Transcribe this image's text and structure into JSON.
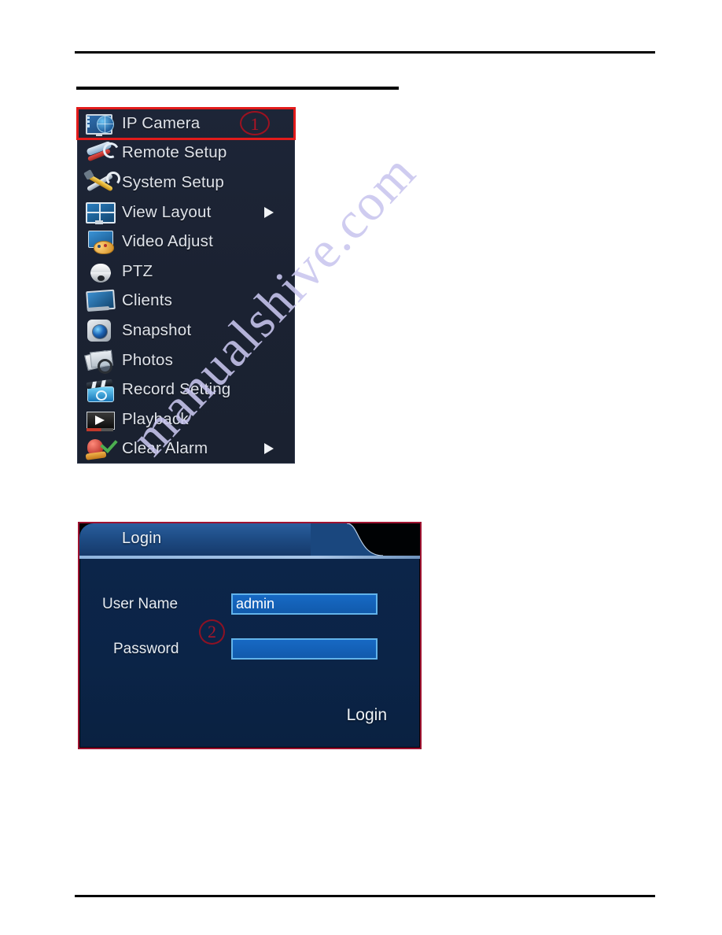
{
  "page": {
    "background_color": "#ffffff",
    "watermark": "manualshive.com",
    "watermark_color": "#c9c6ef"
  },
  "rules": {
    "top": "",
    "heading": "",
    "bottom": ""
  },
  "context_menu": {
    "panel_color": "#1b2232",
    "highlight_color": "#e21b1b",
    "annotation_badge": "1",
    "items": [
      {
        "label": "IP Camera",
        "icon": "ip-camera-icon",
        "has_submenu": false,
        "highlighted": true
      },
      {
        "label": "Remote Setup",
        "icon": "remote-setup-icon",
        "has_submenu": false,
        "highlighted": false
      },
      {
        "label": "System Setup",
        "icon": "system-setup-icon",
        "has_submenu": false,
        "highlighted": false
      },
      {
        "label": "View Layout",
        "icon": "view-layout-icon",
        "has_submenu": true,
        "highlighted": false
      },
      {
        "label": "Video Adjust",
        "icon": "video-adjust-icon",
        "has_submenu": false,
        "highlighted": false
      },
      {
        "label": "PTZ",
        "icon": "ptz-camera-icon",
        "has_submenu": false,
        "highlighted": false
      },
      {
        "label": "Clients",
        "icon": "clients-icon",
        "has_submenu": false,
        "highlighted": false
      },
      {
        "label": "Snapshot",
        "icon": "snapshot-icon",
        "has_submenu": false,
        "highlighted": false
      },
      {
        "label": "Photos",
        "icon": "photos-icon",
        "has_submenu": false,
        "highlighted": false
      },
      {
        "label": "Record Setting",
        "icon": "record-setting-icon",
        "has_submenu": false,
        "highlighted": false
      },
      {
        "label": "Playback",
        "icon": "playback-icon",
        "has_submenu": false,
        "highlighted": false
      },
      {
        "label": "Clear Alarm",
        "icon": "clear-alarm-icon",
        "has_submenu": true,
        "highlighted": false
      }
    ]
  },
  "login_dialog": {
    "tab_title": "Login",
    "border_color": "#9e1230",
    "annotation_badge": "2",
    "fields": [
      {
        "label": "User Name",
        "value": "admin",
        "placeholder": ""
      },
      {
        "label": "Password",
        "value": "",
        "placeholder": ""
      }
    ],
    "submit_label": "Login"
  }
}
